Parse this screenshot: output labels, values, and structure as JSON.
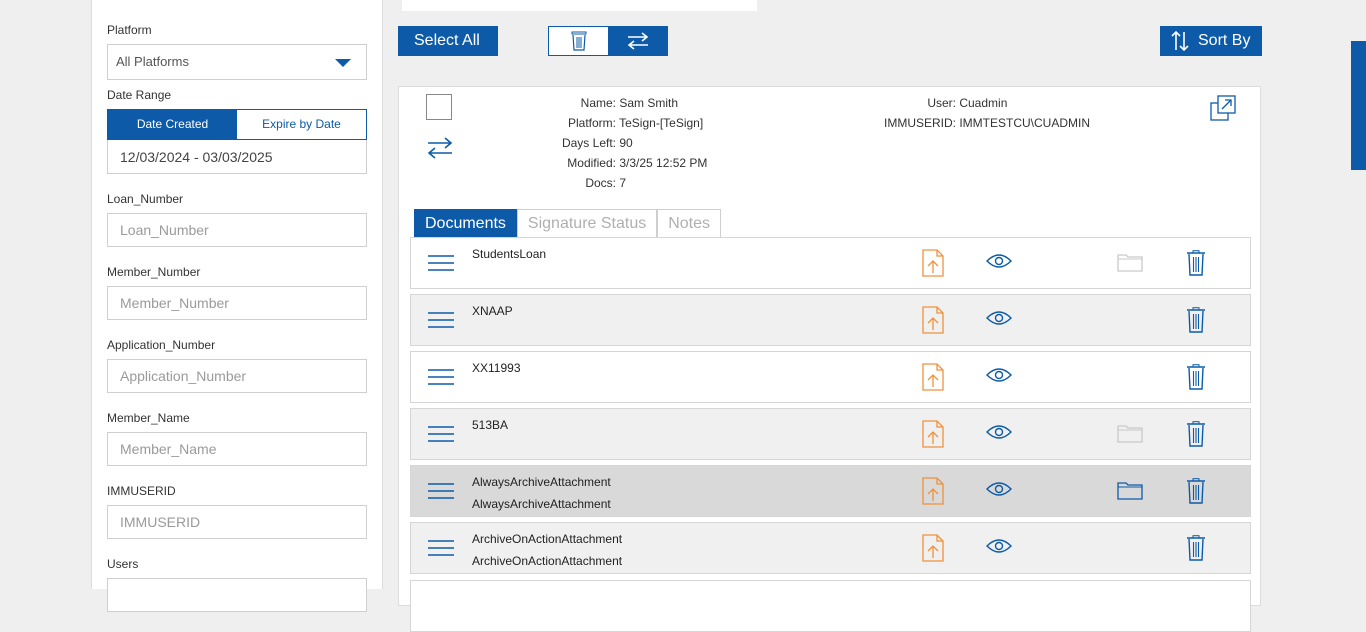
{
  "filters": {
    "platform_label": "Platform",
    "platform_value": "All Platforms",
    "date_range_label": "Date Range",
    "date_created": "Date Created",
    "expire_by_date": "Expire by Date",
    "date_range_value": "12/03/2024 - 03/03/2025",
    "loan_label": "Loan_Number",
    "loan_placeholder": "Loan_Number",
    "member_label": "Member_Number",
    "member_placeholder": "Member_Number",
    "app_label": "Application_Number",
    "app_placeholder": "Application_Number",
    "name_label": "Member_Name",
    "name_placeholder": "Member_Name",
    "immuserid_label": "IMMUSERID",
    "immuserid_placeholder": "IMMUSERID",
    "users_label": "Users"
  },
  "toolbar": {
    "select_all": "Select All",
    "sort_by": "Sort By"
  },
  "record": {
    "name_k": "Name:",
    "name_v": "Sam Smith",
    "platform_k": "Platform:",
    "platform_v": "TeSign-[TeSign]",
    "days_k": "Days Left:",
    "days_v": "90",
    "modified_k": "Modified:",
    "modified_v": "3/3/25 12:52 PM",
    "docs_k": "Docs:",
    "docs_v": "7",
    "user_k": "User:",
    "user_v": "Cuadmin",
    "immuserid_k": "IMMUSERID:",
    "immuserid_v": "IMMTESTCU\\CUADMIN"
  },
  "tabs": {
    "documents": "Documents",
    "signature": "Signature Status",
    "notes": "Notes"
  },
  "documents": [
    {
      "line1": "StudentsLoan",
      "line2": ""
    },
    {
      "line1": "XNAAP",
      "line2": ""
    },
    {
      "line1": "XX11993",
      "line2": ""
    },
    {
      "line1": "513BA",
      "line2": ""
    },
    {
      "line1": "AlwaysArchiveAttachment",
      "line2": "AlwaysArchiveAttachment"
    },
    {
      "line1": "ArchiveOnActionAttachment",
      "line2": "ArchiveOnActionAttachment"
    }
  ],
  "colors": {
    "accent": "#0d5ba8",
    "upload": "#f0913a",
    "folder_inactive": "#c9c9c9",
    "folder_active": "#0d5ba8"
  }
}
